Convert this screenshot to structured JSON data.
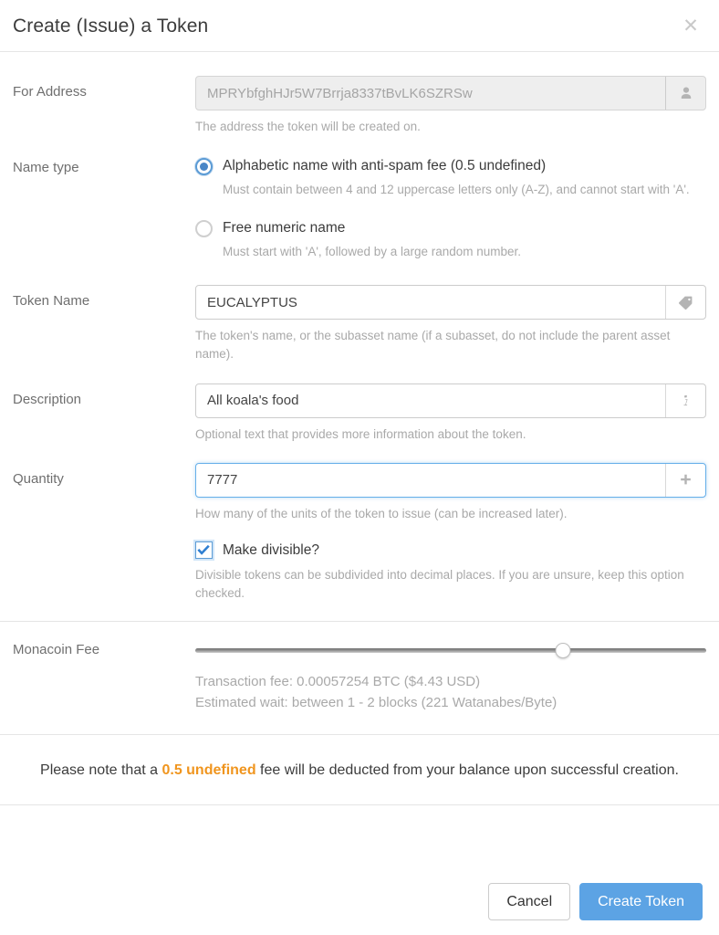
{
  "header": {
    "title": "Create (Issue) a Token",
    "close_icon": "close-icon"
  },
  "fields": {
    "address": {
      "label": "For Address",
      "value": "MPRYbfghHJr5W7Brrja8337tBvLK6SZRSw",
      "placeholder": "",
      "icon": "user-icon",
      "help": "The address the token will be created on."
    },
    "name_type": {
      "label": "Name type",
      "options": [
        {
          "label": "Alphabetic name with anti-spam fee (0.5 undefined)",
          "help": "Must contain between 4 and 12 uppercase letters only (A-Z), and cannot start with 'A'.",
          "selected": true
        },
        {
          "label": "Free numeric name",
          "help": "Must start with 'A', followed by a large random number.",
          "selected": false
        }
      ]
    },
    "token_name": {
      "label": "Token Name",
      "value": "EUCALYPTUS",
      "placeholder": "",
      "icon": "tag-icon",
      "help": "The token's name, or the subasset name (if a subasset, do not include the parent asset name)."
    },
    "description": {
      "label": "Description",
      "value": "All koala's food",
      "placeholder": "",
      "icon": "info-icon",
      "help": "Optional text that provides more information about the token."
    },
    "quantity": {
      "label": "Quantity",
      "value": "7777",
      "placeholder": "",
      "icon": "plus-icon",
      "help": "How many of the units of the token to issue (can be increased later)."
    },
    "divisible": {
      "label": "Make divisible?",
      "checked": true,
      "help": "Divisible tokens can be subdivided into decimal places. If you are unsure, keep this option checked."
    },
    "fee": {
      "label": "Monacoin Fee",
      "slider_percent": 72,
      "transaction_fee": "Transaction fee: 0.00057254 BTC ($4.43 USD)",
      "estimated_wait": "Estimated wait: between 1 - 2 blocks (221 Watanabes/Byte)"
    }
  },
  "note": {
    "prefix": "Please note that a ",
    "highlight": "0.5 undefined",
    "suffix": " fee will be deducted from your balance upon successful creation."
  },
  "footer": {
    "cancel_label": "Cancel",
    "submit_label": "Create Token"
  },
  "colors": {
    "accent": "#5ca3e4",
    "highlight": "#f0951e",
    "border": "#cccccc",
    "muted_text": "#a9a9a9"
  }
}
